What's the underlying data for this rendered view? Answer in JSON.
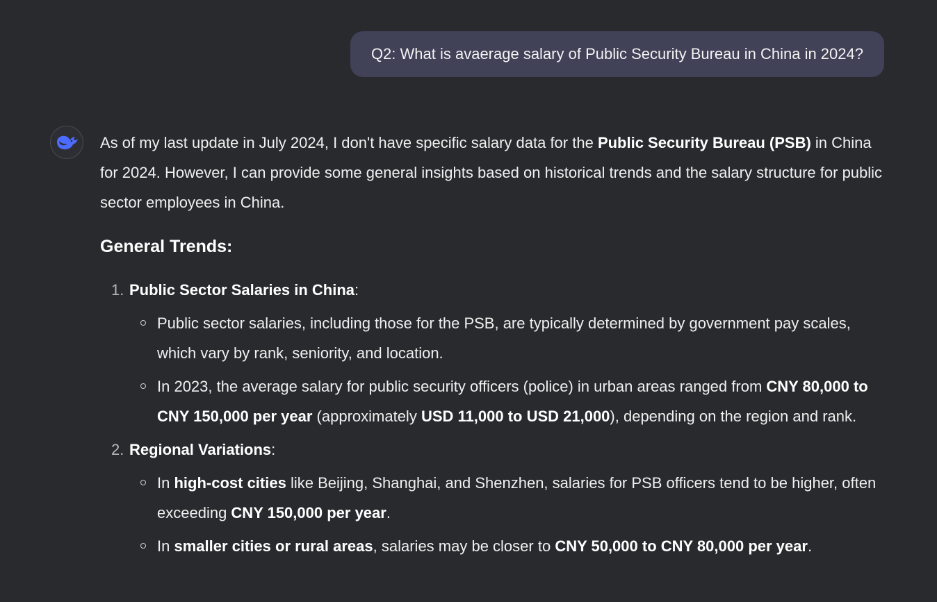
{
  "user_message": {
    "text": "Q2: What is avaerage salary of Public Security Bureau in China in 2024?"
  },
  "assistant": {
    "avatar_icon": "deepseek-whale-icon",
    "intro": {
      "t1": "As of my last update in July 2024, I don't have specific salary data for the ",
      "b1": "Public Security Bureau (PSB)",
      "t2": " in China for 2024. However, I can provide some general insights based on historical trends and the salary structure for public sector employees in China."
    },
    "heading": "General Trends:",
    "sections": [
      {
        "num": "1.",
        "title": "Public Sector Salaries in China",
        "colon": ":",
        "bullets": [
          {
            "t1": "Public sector salaries, including those for the PSB, are typically determined by government pay scales, which vary by rank, seniority, and location."
          },
          {
            "t1": "In 2023, the average salary for public security officers (police) in urban areas ranged from ",
            "b1": "CNY 80,000 to CNY 150,000 per year",
            "t2": " (approximately ",
            "b2": "USD 11,000 to USD 21,000",
            "t3": "), depending on the region and rank."
          }
        ]
      },
      {
        "num": "2.",
        "title": "Regional Variations",
        "colon": ":",
        "bullets": [
          {
            "t1": "In ",
            "b1": "high-cost cities",
            "t2": " like Beijing, Shanghai, and Shenzhen, salaries for PSB officers tend to be higher, often exceeding ",
            "b2": "CNY 150,000 per year",
            "t3": "."
          },
          {
            "t1": "In ",
            "b1": "smaller cities or rural areas",
            "t2": ", salaries may be closer to ",
            "b2": "CNY 50,000 to CNY 80,000 per year",
            "t3": "."
          }
        ]
      }
    ]
  }
}
